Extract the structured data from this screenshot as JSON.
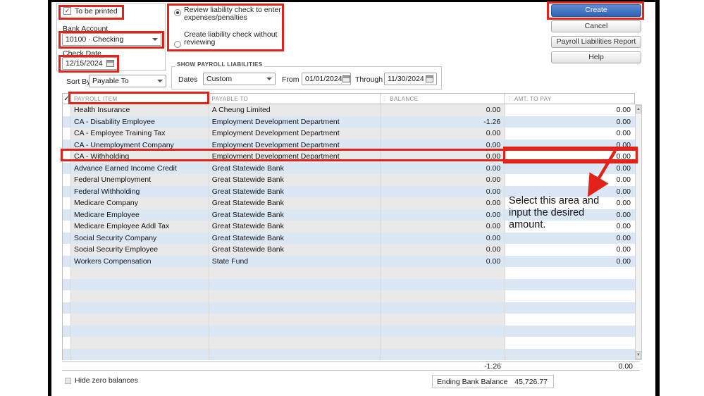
{
  "options_panel": {
    "to_be_printed_label": "To be printed",
    "bank_account_label": "Bank Account",
    "bank_account_value": "10100 · Checking",
    "check_date_label": "Check Date",
    "check_date_value": "12/15/2024",
    "sort_by_label": "Sort By",
    "sort_by_value": "Payable To"
  },
  "radio_group": {
    "option_review": "Review liability check to enter expenses/penalties",
    "option_create": "Create liability check without reviewing"
  },
  "show_liabilities": {
    "title": "SHOW PAYROLL LIABILITIES",
    "dates_label": "Dates",
    "dates_value": "Custom",
    "from_label": "From",
    "from_value": "01/01/2024",
    "through_label": "Through",
    "through_value": "11/30/2024"
  },
  "toolbar": {
    "create_label": "Create",
    "cancel_label": "Cancel",
    "report_label": "Payroll Liabilities Report",
    "help_label": "Help"
  },
  "table": {
    "headers": {
      "check": "✓",
      "payroll_item": "PAYROLL ITEM",
      "payable_to": "PAYABLE TO",
      "balance": "BALANCE",
      "amt_to_pay": "AMT. TO PAY"
    },
    "rows": [
      {
        "item": "Health Insurance",
        "payable": "A Cheung Limited",
        "balance": "0.00",
        "amt": "0.00"
      },
      {
        "item": "CA - Disability Employee",
        "payable": "Employment Development Department",
        "balance": "-1.26",
        "amt": "0.00"
      },
      {
        "item": "CA - Employee Training Tax",
        "payable": "Employment Development Department",
        "balance": "0.00",
        "amt": "0.00"
      },
      {
        "item": "CA - Unemployment Company",
        "payable": "Employment Development Department",
        "balance": "0.00",
        "amt": "0.00"
      },
      {
        "item": "CA - Withholding",
        "payable": "Employment Development Department",
        "balance": "0.00",
        "amt": "0.00"
      },
      {
        "item": "Advance Earned Income Credit",
        "payable": "Great Statewide Bank",
        "balance": "0.00",
        "amt": "0.00"
      },
      {
        "item": "Federal Unemployment",
        "payable": "Great Statewide Bank",
        "balance": "0.00",
        "amt": "0.00"
      },
      {
        "item": "Federal Withholding",
        "payable": "Great Statewide Bank",
        "balance": "0.00",
        "amt": "0.00"
      },
      {
        "item": "Medicare Company",
        "payable": "Great Statewide Bank",
        "balance": "0.00",
        "amt": "0.00"
      },
      {
        "item": "Medicare Employee",
        "payable": "Great Statewide Bank",
        "balance": "0.00",
        "amt": "0.00"
      },
      {
        "item": "Medicare Employee Addl Tax",
        "payable": "Great Statewide Bank",
        "balance": "0.00",
        "amt": "0.00"
      },
      {
        "item": "Social Security Company",
        "payable": "Great Statewide Bank",
        "balance": "0.00",
        "amt": "0.00"
      },
      {
        "item": "Social Security Employee",
        "payable": "Great Statewide Bank",
        "balance": "0.00",
        "amt": "0.00"
      },
      {
        "item": "Workers Compensation",
        "payable": "State Fund",
        "balance": "0.00",
        "amt": "0.00"
      }
    ],
    "empty_rows": 8,
    "highlighted_row_item": "CA - Withholding",
    "totals": {
      "balance": "-1.26",
      "amt_to_pay": "0.00"
    }
  },
  "footer": {
    "hide_zero_label": "Hide zero balances",
    "ending_balance_label": "Ending Bank Balance",
    "ending_balance_value": "45,726.77"
  },
  "annotation": {
    "instruction": "Select this area and input the desired amount."
  },
  "colors": {
    "annotation_red": "#e2231a",
    "create_button_blue": "#3162b3",
    "stripe_gray": "#e9e9e9",
    "stripe_blue": "#dce7f5"
  }
}
